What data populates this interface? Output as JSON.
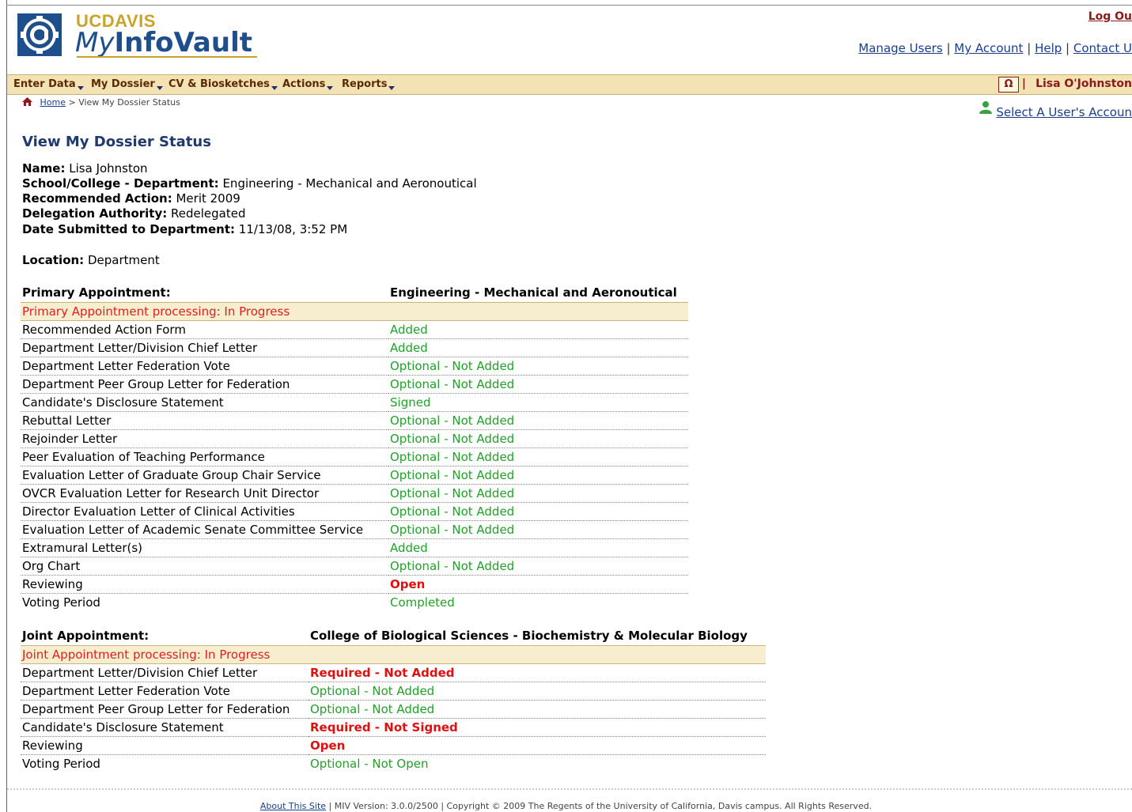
{
  "header": {
    "brand_uc": "UC",
    "brand_davis": "DAVIS",
    "brand_my": "My",
    "brand_infovault": "InfoVault",
    "logout": "Log Ou",
    "links": [
      "Manage Users",
      "My Account",
      "Help",
      "Contact U"
    ],
    "link_separator": "|"
  },
  "menu": {
    "items": [
      "Enter Data",
      "My Dossier",
      "CV & Biosketches",
      "Actions",
      "Reports"
    ],
    "omega": "Ω",
    "separator": "|",
    "user": "Lisa O'Johnston"
  },
  "breadcrumb": {
    "home": "Home",
    "current": "> View My Dossier Status",
    "select_user": "Select A User's Accoun"
  },
  "page": {
    "title": "View My Dossier Status",
    "name_label": "Name:",
    "name": "Lisa Johnston",
    "school_label": "School/College - Department:",
    "school": "Engineering - Mechanical and Aeronoutical",
    "action_label": "Recommended Action:",
    "action": "Merit 2009",
    "delegation_label": "Delegation Authority:",
    "delegation": "Redelegated",
    "submitted_label": "Date Submitted to Department:",
    "submitted": "11/13/08, 3:52 PM",
    "location_label": "Location:",
    "location": "Department"
  },
  "primary": {
    "label": "Primary Appointment:",
    "dept": "Engineering - Mechanical and Aeronoutical",
    "processing": "Primary Appointment processing: In Progress",
    "rows": [
      {
        "item": "Recommended Action Form",
        "status": "Added",
        "style": "green"
      },
      {
        "item": "Department Letter/Division Chief Letter",
        "status": "Added",
        "style": "green"
      },
      {
        "item": "Department Letter Federation Vote",
        "status": "Optional - Not Added",
        "style": "green"
      },
      {
        "item": "Department Peer Group Letter for Federation",
        "status": "Optional - Not Added",
        "style": "green"
      },
      {
        "item": "Candidate's Disclosure Statement",
        "status": "Signed",
        "style": "green"
      },
      {
        "item": "Rebuttal Letter",
        "status": "Optional - Not Added",
        "style": "green"
      },
      {
        "item": "Rejoinder Letter",
        "status": "Optional - Not Added",
        "style": "green"
      },
      {
        "item": "Peer Evaluation of Teaching Performance",
        "status": "Optional - Not Added",
        "style": "green"
      },
      {
        "item": "Evaluation Letter of Graduate Group Chair Service",
        "status": "Optional - Not Added",
        "style": "green"
      },
      {
        "item": "OVCR Evaluation Letter for Research Unit Director",
        "status": "Optional - Not Added",
        "style": "green"
      },
      {
        "item": "Director Evaluation Letter of Clinical Activities",
        "status": "Optional - Not Added",
        "style": "green"
      },
      {
        "item": "Evaluation Letter of Academic Senate Committee Service",
        "status": "Optional - Not Added",
        "style": "green"
      },
      {
        "item": "Extramural Letter(s)",
        "status": "Added",
        "style": "green"
      },
      {
        "item": "Org Chart",
        "status": "Optional - Not Added",
        "style": "green"
      },
      {
        "item": "Reviewing",
        "status": "Open",
        "style": "red"
      },
      {
        "item": "Voting Period",
        "status": "Completed",
        "style": "green"
      }
    ]
  },
  "joint": {
    "label": "Joint Appointment:",
    "dept": "College of Biological Sciences - Biochemistry & Molecular Biology",
    "processing": "Joint Appointment processing: In Progress",
    "rows": [
      {
        "item": "Department Letter/Division Chief Letter",
        "status": "Required - Not Added",
        "style": "red"
      },
      {
        "item": "Department Letter Federation Vote",
        "status": "Optional - Not Added",
        "style": "green"
      },
      {
        "item": "Department Peer Group Letter for Federation",
        "status": "Optional - Not Added",
        "style": "green"
      },
      {
        "item": "Candidate's Disclosure Statement",
        "status": "Required - Not Signed",
        "style": "red"
      },
      {
        "item": "Reviewing",
        "status": "Open",
        "style": "red"
      },
      {
        "item": "Voting Period",
        "status": "Optional - Not Open",
        "style": "green"
      }
    ]
  },
  "footer": {
    "about": "About This Site",
    "text": "| MIV Version: 3.0.0/2500 | Copyright © 2009 The Regents of the University of California, Davis campus. All Rights Reserved."
  },
  "colors": {
    "menubar": "#f3e3b4",
    "brand_blue": "#1f4e8c",
    "brand_gold": "#c9a32a",
    "status_green": "#22a02a",
    "status_red": "#e01010"
  }
}
